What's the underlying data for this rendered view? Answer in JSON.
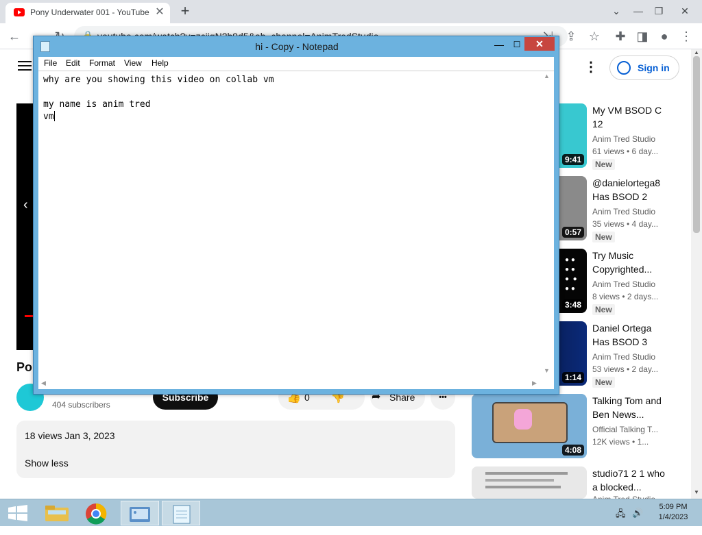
{
  "browser": {
    "tab_title": "Pony Underwater 001 - YouTube",
    "tab_close": "✕",
    "new_tab": "+",
    "url": "youtube.com/watch?v=zciigN2b9d5&ab_channel=AnimTredStudio",
    "window_controls": {
      "minimize": "⌄",
      "restore": "❐",
      "close": "✕"
    }
  },
  "youtube": {
    "signin_label": "Sign in",
    "video_title": "Por",
    "subscribers": "404 subscribers",
    "subscribe_label": "Subscribe",
    "like_count": "0",
    "share_label": "Share",
    "more_label": "•••",
    "description": {
      "meta": "18 views  Jan 3, 2023",
      "show_less": "Show less"
    },
    "recommendations": [
      {
        "title": "My VM BSOD C 12",
        "channel": "Anim Tred Studio",
        "views": "61 views • 6 day...",
        "badge": "New",
        "duration": "9:41",
        "thumb": "#38c8d0"
      },
      {
        "title": "@danielortega8 Has BSOD 2",
        "channel": "Anim Tred Studio",
        "views": "35 views • 4 day...",
        "badge": "New",
        "duration": "0:57",
        "thumb": "#8a8a8a"
      },
      {
        "title": "Try Music Copyrighted...",
        "channel": "Anim Tred Studio",
        "views": "8 views • 2 days...",
        "badge": "New",
        "duration": "3:48",
        "thumb": "#050505"
      },
      {
        "title": "Daniel Ortega Has BSOD 3",
        "channel": "Anim Tred Studio",
        "views": "53 views • 2 day...",
        "badge": "New",
        "duration": "1:14",
        "thumb": "#0b2a7a"
      },
      {
        "title": "Talking Tom and Ben News...",
        "channel": "Official Talking T...",
        "views": "12K views • 1...",
        "badge": "",
        "duration": "4:08",
        "thumb": "#7ab0d8"
      },
      {
        "title": "studio71 2 1 who a blocked...",
        "channel": "Anim Tred Studio",
        "views": "",
        "badge": "",
        "duration": "",
        "thumb": "#e8e8e8"
      }
    ]
  },
  "notepad": {
    "title": "hi - Copy - Notepad",
    "menu": [
      "File",
      "Edit",
      "Format",
      "View",
      "Help"
    ],
    "lines": [
      "why are you showing this video on collab vm",
      "",
      "my name is anim tred",
      "vm"
    ],
    "controls": {
      "minimize": "—",
      "maximize": "☐",
      "close": "✕"
    }
  },
  "taskbar": {
    "time": "5:09 PM",
    "date": "1/4/2023"
  }
}
